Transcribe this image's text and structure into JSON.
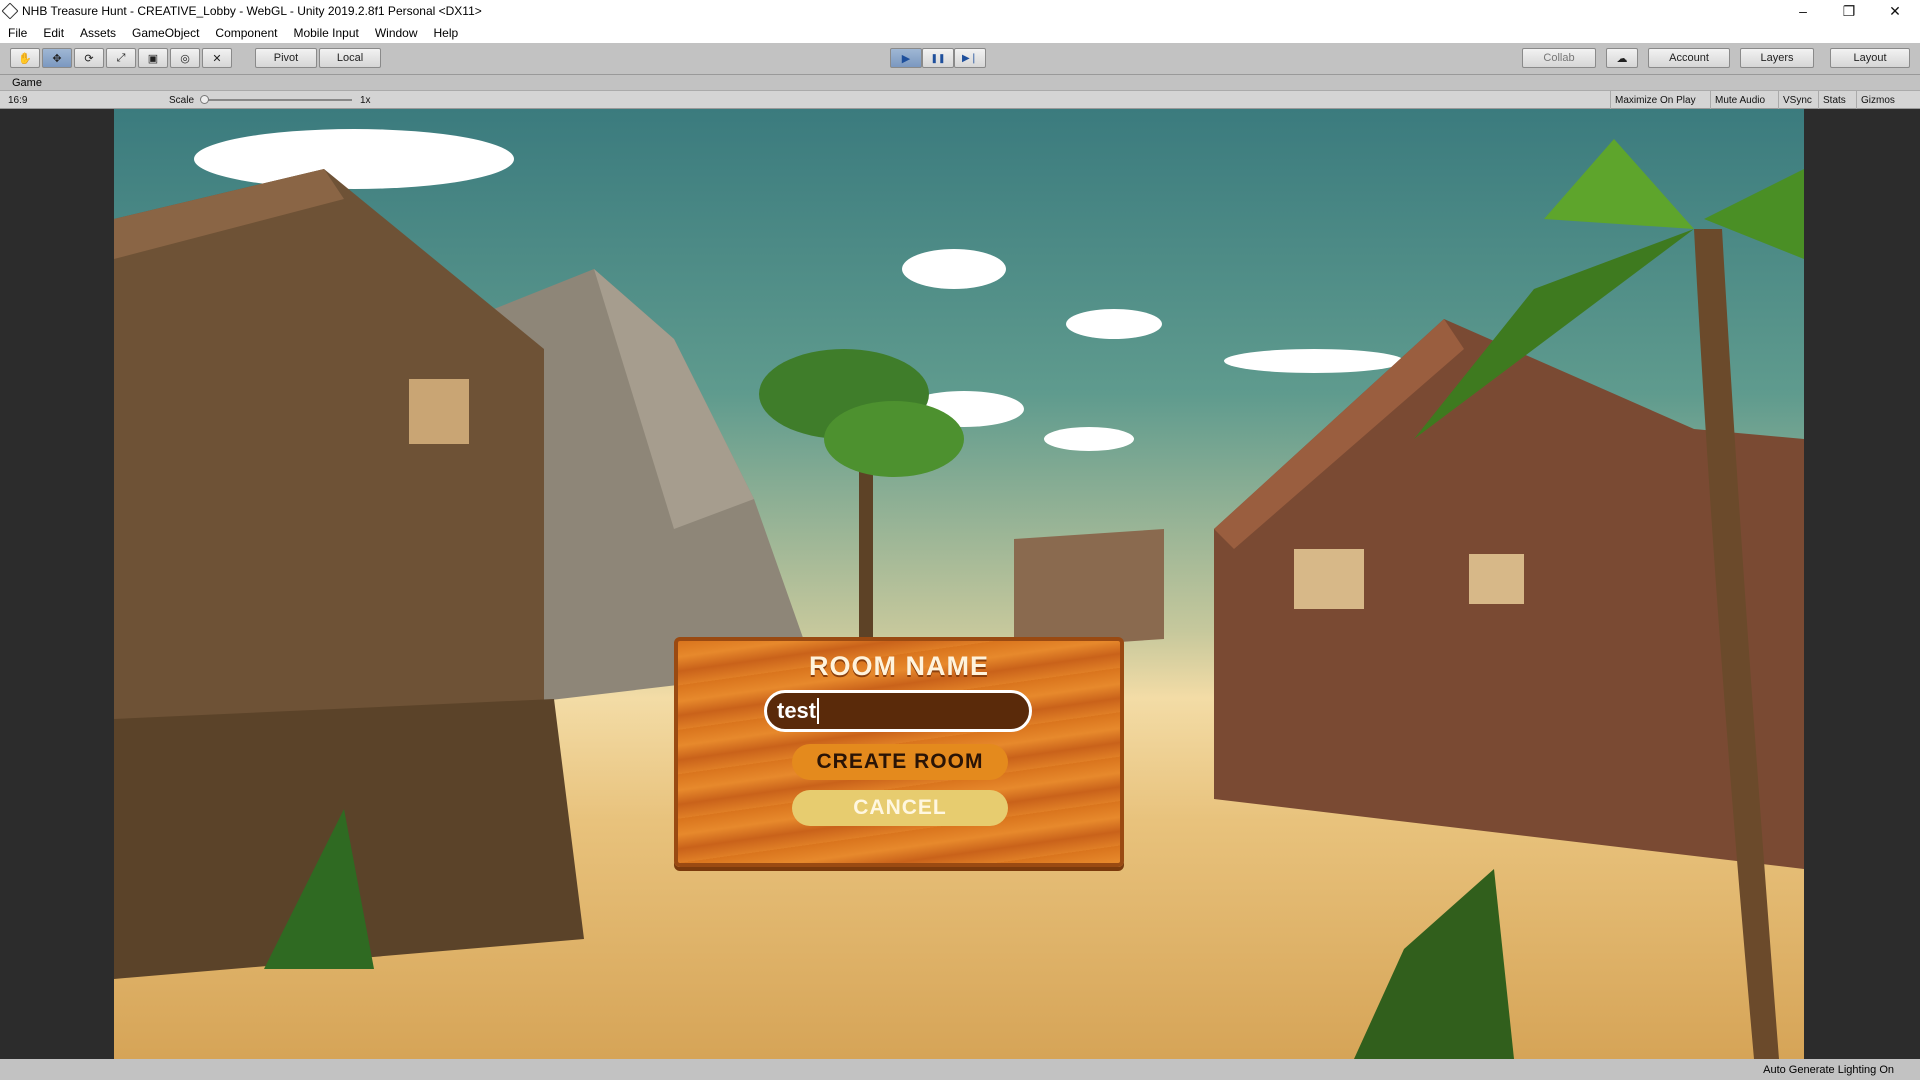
{
  "window": {
    "title": "NHB Treasure Hunt - CREATIVE_Lobby - WebGL - Unity 2019.2.8f1 Personal <DX11>",
    "min": "–",
    "max": "❐",
    "close": "✕"
  },
  "menu": [
    "File",
    "Edit",
    "Assets",
    "GameObject",
    "Component",
    "Mobile Input",
    "Window",
    "Help"
  ],
  "toolbar": {
    "pivot": "Pivot",
    "local": "Local",
    "collab": "Collab",
    "account": "Account",
    "layers": "Layers",
    "layout": "Layout",
    "play": "▶",
    "pause": "❚❚",
    "step": "▶❘"
  },
  "game": {
    "tab": "Game",
    "aspect": "16:9",
    "scale_label": "Scale",
    "scale_value": "1x",
    "maximize": "Maximize On Play",
    "mute": "Mute Audio",
    "vsync": "VSync",
    "stats": "Stats",
    "gizmos": "Gizmos"
  },
  "dialog": {
    "title": "ROOM NAME",
    "input_value": "test",
    "create": "CREATE ROOM",
    "cancel": "CANCEL"
  },
  "status": "Auto Generate Lighting On",
  "icons": [
    "hand-icon",
    "move-icon",
    "rotate-icon",
    "scale-icon",
    "rect-icon",
    "transform-icon",
    "custom-tool-icon",
    "cloud-icon"
  ]
}
